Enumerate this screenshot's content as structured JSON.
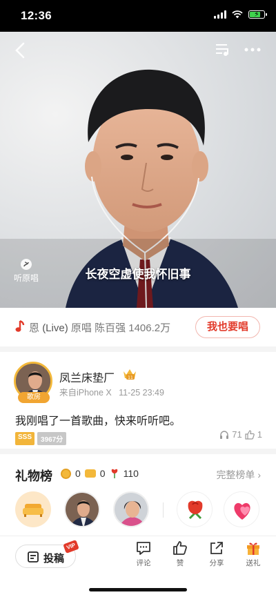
{
  "status_bar": {
    "time": "12:36"
  },
  "player": {
    "lyric": "长夜空虚使我怀旧事",
    "original_label": "听原唱"
  },
  "song": {
    "title_fragment": "恩",
    "live_tag": "(Live)",
    "original_prefix": "原唱",
    "original_singer": "陈百强",
    "play_count": "1406.2万",
    "sing_button": "我也要唱"
  },
  "user": {
    "name": "凤兰床垫厂",
    "level_badge": "11",
    "avatar_badge": "歌房",
    "device": "来自iPhone X",
    "datetime": "11-25 23:49",
    "message": "我刚唱了一首歌曲，快来听听吧。",
    "grade": "SSS",
    "score": "3967分",
    "listens": "71",
    "likes": "1"
  },
  "gift_board": {
    "title": "礼物榜",
    "coin_count": "0",
    "ticket_count": "0",
    "flower_count": "110",
    "full_list": "完整榜单"
  },
  "bottom_bar": {
    "submit": "投稿",
    "vip": "VIP",
    "comment": "评论",
    "like": "赞",
    "share": "分享",
    "gift": "送礼"
  },
  "colors": {
    "accent_red": "#e23a2a",
    "gold": "#f3b83a",
    "suit_navy": "#1f2a4a"
  }
}
